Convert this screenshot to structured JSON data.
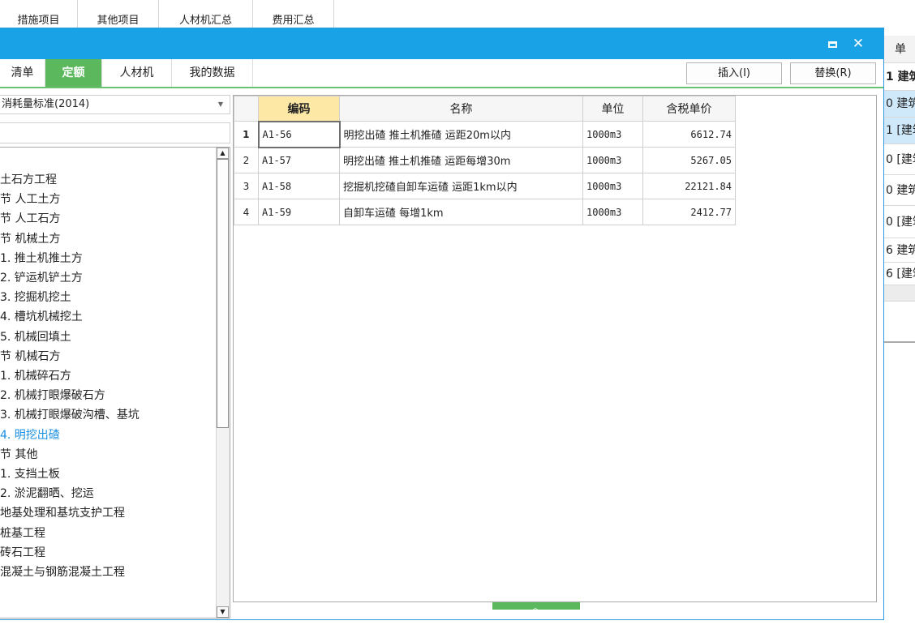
{
  "top_tabs": [
    "措施项目",
    "其他项目",
    "人材机汇总",
    "费用汇总"
  ],
  "dialog": {
    "tabs": [
      "清单",
      "定额",
      "人材机",
      "我的数据"
    ],
    "active_tab": "定额",
    "insert_label": "插入(I)",
    "replace_label": "替换(R)",
    "standard": "消耗量标准(2014)",
    "search_value": ""
  },
  "tree": [
    {
      "label": "土石方工程",
      "selected": false
    },
    {
      "label": "节 人工土方",
      "selected": false
    },
    {
      "label": "节 人工石方",
      "selected": false
    },
    {
      "label": "节 机械土方",
      "selected": false
    },
    {
      "label": "1. 推土机推土方",
      "selected": false
    },
    {
      "label": "2. 铲运机铲土方",
      "selected": false
    },
    {
      "label": "3. 挖掘机挖土",
      "selected": false
    },
    {
      "label": "4. 槽坑机械挖土",
      "selected": false
    },
    {
      "label": "5. 机械回填土",
      "selected": false
    },
    {
      "label": "节 机械石方",
      "selected": false
    },
    {
      "label": "1. 机械碎石方",
      "selected": false
    },
    {
      "label": "2. 机械打眼爆破石方",
      "selected": false
    },
    {
      "label": "3. 机械打眼爆破沟槽、基坑",
      "selected": false
    },
    {
      "label": "4. 明挖出碴",
      "selected": true
    },
    {
      "label": "节 其他",
      "selected": false
    },
    {
      "label": "1. 支挡土板",
      "selected": false
    },
    {
      "label": "2. 淤泥翻晒、挖运",
      "selected": false
    },
    {
      "label": "地基处理和基坑支护工程",
      "selected": false
    },
    {
      "label": "桩基工程",
      "selected": false
    },
    {
      "label": "砖石工程",
      "selected": false
    },
    {
      "label": "混凝土与钢筋混凝土工程",
      "selected": false
    }
  ],
  "grid": {
    "columns": [
      "编码",
      "名称",
      "单位",
      "含税单价"
    ],
    "rows": [
      {
        "num": "1",
        "code": "A1-56",
        "name": "明挖出碴 推土机推碴 运距20m以内",
        "unit": "1000m3",
        "price": "6612.74"
      },
      {
        "num": "2",
        "code": "A1-57",
        "name": "明挖出碴 推土机推碴 运距每增30m",
        "unit": "1000m3",
        "price": "5267.05"
      },
      {
        "num": "3",
        "code": "A1-58",
        "name": "挖掘机挖碴自卸车运碴 运距1km以内",
        "unit": "1000m3",
        "price": "22121.84"
      },
      {
        "num": "4",
        "code": "A1-59",
        "name": "自卸车运碴 每增1km",
        "unit": "1000m3",
        "price": "2412.77"
      }
    ]
  },
  "bg_right": {
    "header": "单",
    "rows": [
      "1 建筑",
      "0 建筑",
      "1 [建筑",
      "0 [建筑",
      "0 建筑",
      "0 [建筑",
      "6 建筑",
      "6 [建筑"
    ]
  },
  "colors": {
    "title_bar": "#19a3e6",
    "active_tab": "#5cb85c",
    "selected_tree": "#1a8fe0",
    "sorted_header": "#fde8a6"
  }
}
